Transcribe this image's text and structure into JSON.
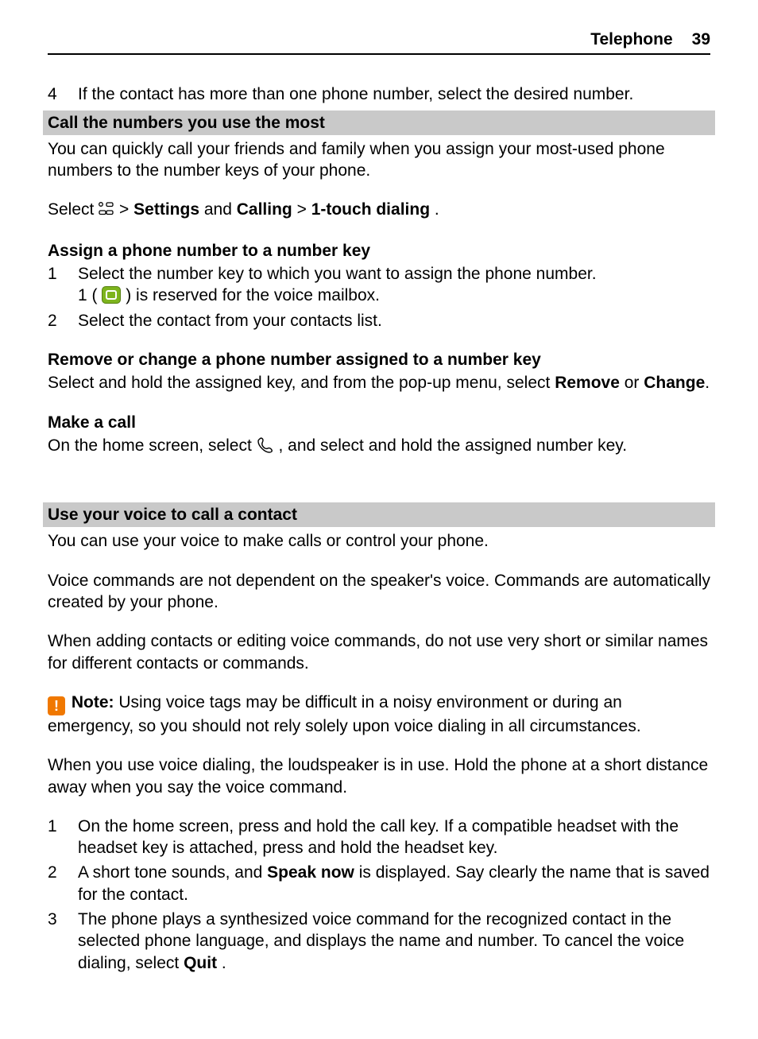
{
  "header": {
    "title": "Telephone",
    "page": "39"
  },
  "step4": {
    "num": "4",
    "text": "If the contact has more than one phone number, select the desired number."
  },
  "sec1": {
    "title": "Call the numbers you use the most",
    "intro": "You can quickly call your friends and family when you assign your most-used phone numbers to the number keys of your phone.",
    "sel_prefix": "Select ",
    "sel_gt1": " > ",
    "settings": "Settings",
    "and": " and ",
    "calling": "Calling",
    "sel_gt2": "  > ",
    "one_touch": "1-touch dialing",
    "period": ".",
    "assign_head": "Assign a phone number to a number key",
    "assign_steps": [
      {
        "num": "1",
        "line1": "Select the number key to which you want to assign the phone number.",
        "line2a": "1 (",
        "line2b": " ) is reserved for the voice mailbox."
      },
      {
        "num": "2",
        "text": "Select the contact from your contacts list."
      }
    ],
    "remove_head": "Remove or change a phone number assigned to a number key",
    "remove_a": "Select and hold the assigned key, and from the pop-up menu, select ",
    "remove_bold": "Remove",
    "remove_b": " or ",
    "change_bold": "Change",
    "make_head": "Make a call",
    "make_a": "On the home screen, select ",
    "make_b": " , and select and hold the assigned number key."
  },
  "sec2": {
    "title": "Use your voice to call a contact",
    "p1": "You can use your voice to make calls or control your phone.",
    "p2": "Voice commands are not dependent on the speaker's voice. Commands are automatically created by your phone.",
    "p3": "When adding contacts or editing voice commands, do not use very short or similar names for different contacts or commands.",
    "note_icon": "!",
    "note_label": "Note:",
    "note_text": " Using voice tags may be difficult in a noisy environment or during an emergency, so you should not rely solely upon voice dialing in all circumstances.",
    "p4": "When you use voice dialing, the loudspeaker is in use. Hold the phone at a short distance away when you say the voice command.",
    "steps": [
      {
        "num": "1",
        "text": "On the home screen, press and hold the call key. If a compatible headset with the headset key is attached, press and hold the headset key."
      },
      {
        "num": "2",
        "a": "A short tone sounds, and ",
        "bold": "Speak now",
        "b": " is displayed. Say clearly the name that is saved for the contact."
      },
      {
        "num": "3",
        "a": "The phone plays a synthesized voice command for the recognized contact in the selected phone language, and displays the name and number. To cancel the voice dialing, select ",
        "bold": "Quit",
        "b": "."
      }
    ]
  }
}
